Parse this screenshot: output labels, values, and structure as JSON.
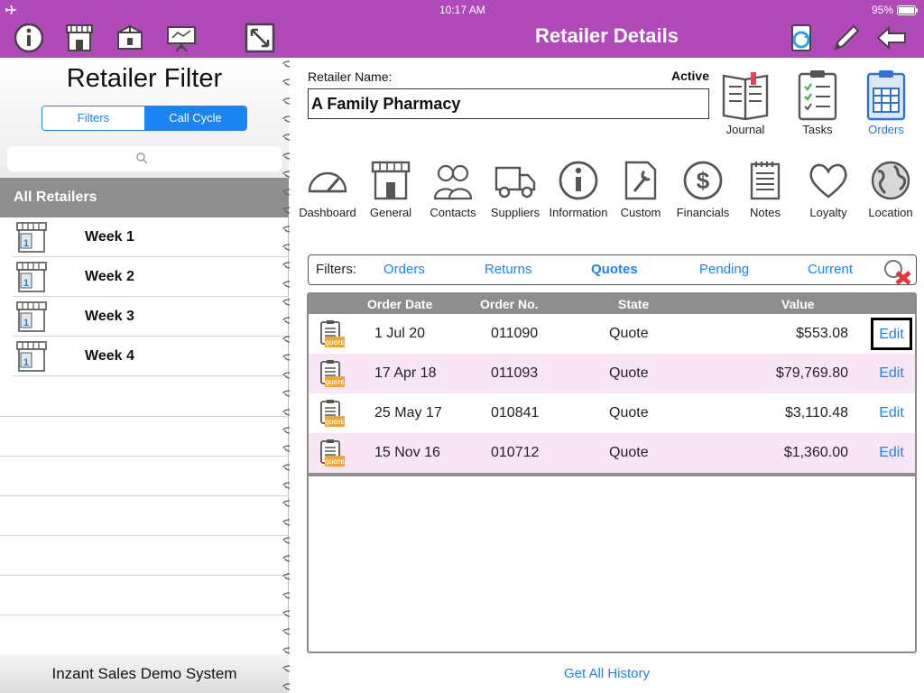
{
  "status_bar": {
    "time": "10:17 AM",
    "battery": "95%"
  },
  "header": {
    "title": "Retailer Details"
  },
  "left_panel": {
    "title": "Retailer Filter",
    "segments": [
      "Filters",
      "Call Cycle"
    ],
    "selected_segment": "Call Cycle",
    "search_placeholder": "",
    "section_header": "All Retailers",
    "weeks": [
      "Week 1",
      "Week 2",
      "Week 3",
      "Week 4"
    ],
    "footer": "Inzant Sales Demo System"
  },
  "retailer": {
    "name_label": "Retailer Name:",
    "status": "Active",
    "name": "A Family Pharmacy"
  },
  "top_actions": [
    "Journal",
    "Tasks",
    "Orders"
  ],
  "nav_icons": [
    "Dashboard",
    "General",
    "Contacts",
    "Suppliers",
    "Information",
    "Custom",
    "Financials",
    "Notes",
    "Loyalty",
    "Location"
  ],
  "filters": {
    "label": "Filters:",
    "options": [
      "Orders",
      "Returns",
      "Quotes",
      "Pending",
      "Current"
    ],
    "selected": "Quotes"
  },
  "table": {
    "columns": [
      "Order Date",
      "Order No.",
      "State",
      "Value"
    ],
    "rows": [
      {
        "date": "1 Jul 20",
        "number": "011090",
        "state": "Quote",
        "value": "$553.08",
        "action": "Edit"
      },
      {
        "date": "17 Apr 18",
        "number": "011093",
        "state": "Quote",
        "value": "$79,769.80",
        "action": "Edit"
      },
      {
        "date": "25 May 17",
        "number": "010841",
        "state": "Quote",
        "value": "$3,110.48",
        "action": "Edit"
      },
      {
        "date": "15 Nov 16",
        "number": "010712",
        "state": "Quote",
        "value": "$1,360.00",
        "action": "Edit"
      }
    ],
    "icon_text": "QUOTE"
  },
  "get_all_history": "Get All History",
  "colors": {
    "header": "#b04ab8",
    "accent": "#1a84f5",
    "row_alt": "#f8e6f6",
    "orders_blue": "#2a74d9"
  }
}
